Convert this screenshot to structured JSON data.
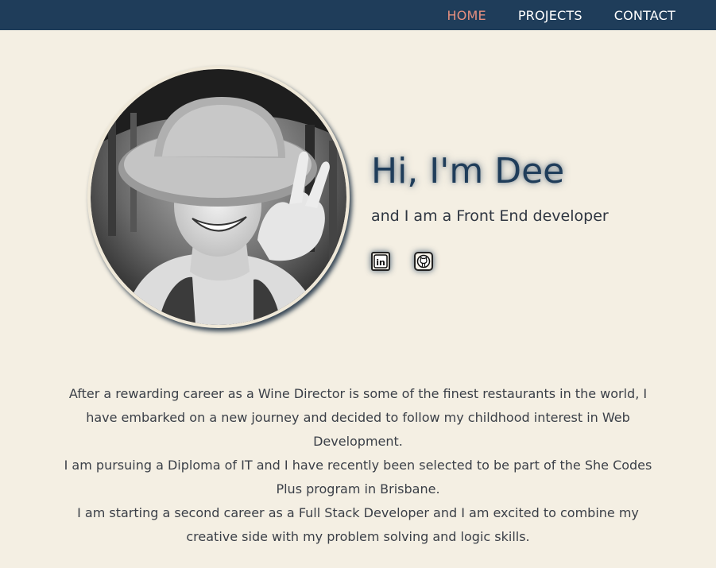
{
  "nav": {
    "items": [
      {
        "label": "HOME",
        "active": true
      },
      {
        "label": "PROJECTS",
        "active": false
      },
      {
        "label": "CONTACT",
        "active": false
      }
    ]
  },
  "hero": {
    "avatar_icon": "profile-photo",
    "title": "Hi, I'm Dee",
    "subtitle": "and I am a Front End developer",
    "social": [
      {
        "icon": "linkedin-icon"
      },
      {
        "icon": "github-icon"
      }
    ]
  },
  "about": {
    "paragraphs": [
      "After a rewarding career as a Wine Director is some of the finest restaurants in the world, I have embarked on a new journey and decided to follow my childhood interest in Web Development.",
      "I am pursuing a Diploma of IT and I have recently been selected to be part of the She Codes Plus program in Brisbane.",
      "I am starting a second career as a Full Stack Developer and I am excited to combine my creative side with my problem solving and logic skills."
    ]
  },
  "colors": {
    "navbar": "#1f3d5a",
    "nav_active": "#e58f7f",
    "background": "#f4efe3",
    "title": "#1f3d5a"
  }
}
